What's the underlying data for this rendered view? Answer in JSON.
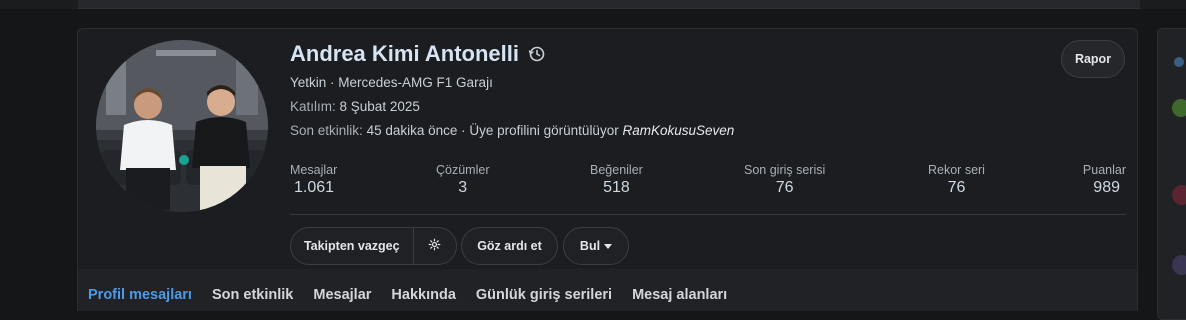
{
  "profile": {
    "name": "Andrea Kimi Antonelli",
    "role": "Yetkin · Mercedes-AMG F1 Garajı",
    "joined_label": "Katılım:",
    "joined_value": "8 Şubat 2025",
    "activity_label": "Son etkinlik:",
    "activity_value": "45 dakika önce · Üye profilini görüntülüyor",
    "activity_user": "RamKokusuSeven",
    "report_label": "Rapor"
  },
  "stats": [
    {
      "label": "Mesajlar",
      "value": "1.061"
    },
    {
      "label": "Çözümler",
      "value": "3"
    },
    {
      "label": "Beğeniler",
      "value": "518"
    },
    {
      "label": "Son giriş serisi",
      "value": "76"
    },
    {
      "label": "Rekor seri",
      "value": "76"
    },
    {
      "label": "Puanlar",
      "value": "989"
    }
  ],
  "actions": {
    "unfollow": "Takipten vazgeç",
    "ignore": "Göz ardı et",
    "find": "Bul"
  },
  "tabs": [
    {
      "label": "Profil mesajları",
      "active": true
    },
    {
      "label": "Son etkinlik"
    },
    {
      "label": "Mesajlar"
    },
    {
      "label": "Hakkında"
    },
    {
      "label": "Günlük giriş serileri"
    },
    {
      "label": "Mesaj alanları"
    }
  ],
  "colors": {
    "accent": "#4f9ae6",
    "background": "#151618",
    "card": "#1b1d20"
  },
  "icons": [
    "history-icon",
    "gear-icon",
    "caret-down-icon"
  ]
}
